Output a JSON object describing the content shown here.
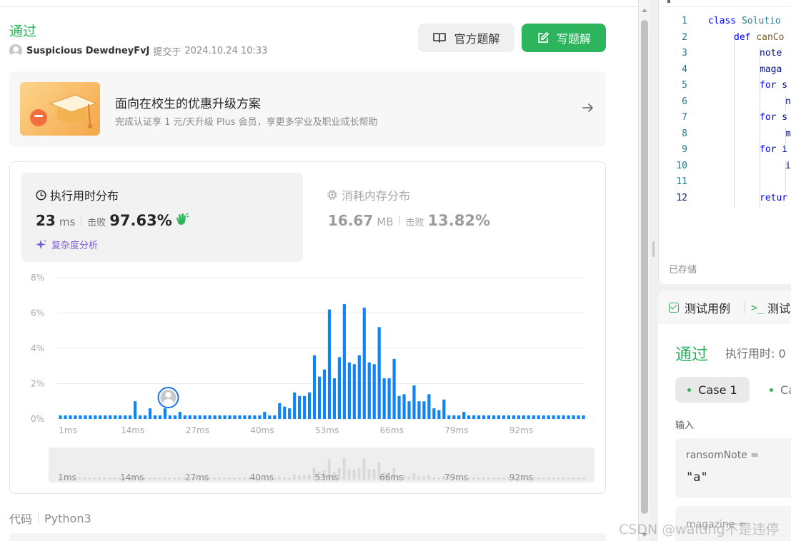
{
  "submission": {
    "status": "通过",
    "user": "Suspicious DewdneyFvJ",
    "submitted_prefix": "提交于",
    "submitted_at": "2024.10.24 10:33",
    "official_solution_label": "官方题解",
    "write_solution_label": "写题解"
  },
  "promo": {
    "title": "面向在校生的优惠升级方案",
    "subtitle": "完成认证享 1 元/天升级 Plus 会员，享更多学业及职业成长帮助"
  },
  "runtime": {
    "label": "执行用时分布",
    "value": "23",
    "unit": "ms",
    "beat_label": "击败",
    "beat_pct": "97.63%",
    "analysis_label": "复杂度分析"
  },
  "memory": {
    "label": "消耗内存分布",
    "value": "16.67",
    "unit": "MB",
    "beat_label": "击败",
    "beat_pct": "13.82%"
  },
  "chart_data": {
    "type": "bar",
    "title": "",
    "xlabel": "",
    "ylabel": "",
    "ylim": [
      0,
      8
    ],
    "y_tick_labels": [
      "0%",
      "2%",
      "4%",
      "6%",
      "8%"
    ],
    "x_tick_labels": [
      "1ms",
      "14ms",
      "27ms",
      "40ms",
      "53ms",
      "66ms",
      "79ms",
      "92ms"
    ],
    "x": [
      1,
      2,
      3,
      4,
      5,
      6,
      7,
      8,
      9,
      10,
      11,
      12,
      13,
      14,
      15,
      16,
      17,
      18,
      19,
      20,
      21,
      22,
      23,
      24,
      25,
      26,
      27,
      28,
      29,
      30,
      31,
      32,
      33,
      34,
      35,
      36,
      37,
      38,
      39,
      40,
      41,
      42,
      43,
      44,
      45,
      46,
      47,
      48,
      49,
      50,
      51,
      52,
      53,
      54,
      55,
      56,
      57,
      58,
      59,
      60,
      61,
      62,
      63,
      64,
      65,
      66,
      67,
      68,
      69,
      70,
      71,
      72,
      73,
      74,
      75,
      76,
      77,
      78,
      79,
      80,
      81,
      82,
      83,
      84,
      85,
      86,
      87,
      88,
      89,
      90,
      91,
      92,
      93,
      94,
      95,
      96,
      97,
      98,
      99,
      100,
      101,
      102,
      103,
      104,
      105,
      106
    ],
    "values": [
      0.2,
      0.2,
      0.2,
      0.2,
      0.2,
      0.2,
      0.2,
      0.2,
      0.2,
      0.2,
      0.2,
      0.2,
      0.2,
      0.2,
      0.2,
      1.0,
      0.2,
      0.2,
      0.6,
      0.2,
      0.2,
      0.6,
      0.2,
      0.2,
      0.4,
      0.2,
      0.2,
      0.2,
      0.2,
      0.2,
      0.2,
      0.2,
      0.2,
      0.2,
      0.2,
      0.2,
      0.2,
      0.2,
      0.2,
      0.2,
      0.2,
      0.4,
      0.2,
      0.2,
      0.9,
      0.7,
      0.6,
      1.5,
      1.3,
      1.3,
      1.5,
      3.6,
      2.4,
      2.8,
      6.2,
      2.3,
      3.5,
      6.5,
      3.2,
      3.1,
      3.6,
      6.3,
      3.2,
      3.1,
      5.2,
      2.3,
      2.3,
      3.4,
      1.3,
      1.4,
      1.0,
      1.9,
      1.0,
      1.0,
      1.4,
      0.6,
      0.5,
      1.1,
      0.2,
      0.2,
      0.2,
      0.4,
      0.2,
      0.2,
      0.2,
      0.2,
      0.2,
      0.2,
      0.2,
      0.2,
      0.2,
      0.2,
      0.2,
      0.2,
      0.2,
      0.2,
      0.2,
      0.2,
      0.2,
      0.2,
      0.2,
      0.2,
      0.2,
      0.2,
      0.2,
      0.2
    ],
    "highlight_x": 23,
    "grid": true
  },
  "code_footer": {
    "label": "代码",
    "language": "Python3"
  },
  "editor": {
    "line_numbers": [
      "1",
      "2",
      "3",
      "4",
      "5",
      "6",
      "7",
      "8",
      "9",
      "10",
      "11",
      "12"
    ],
    "lines": [
      {
        "indent": 0,
        "kw": "class",
        "rest": "Solutio",
        "cls": true
      },
      {
        "indent": 1,
        "kw": "def",
        "rest": "canCo",
        "fn": true
      },
      {
        "indent": 2,
        "kw": "",
        "rest": "note"
      },
      {
        "indent": 2,
        "kw": "",
        "rest": "maga"
      },
      {
        "indent": 2,
        "kw": "for",
        "rest": "s"
      },
      {
        "indent": 3,
        "kw": "",
        "rest": "n"
      },
      {
        "indent": 2,
        "kw": "for",
        "rest": "s"
      },
      {
        "indent": 3,
        "kw": "",
        "rest": "m"
      },
      {
        "indent": 2,
        "kw": "for",
        "rest": "i"
      },
      {
        "indent": 3,
        "kw": "",
        "rest": "i"
      },
      {
        "indent": 4,
        "kw": "",
        "rest": ""
      },
      {
        "indent": 2,
        "kw": "retur",
        "rest": ""
      }
    ],
    "saved_label": "已存储"
  },
  "test_panel": {
    "tab_testcase": "测试用例",
    "tab_result": "测试",
    "status": "通过",
    "runtime_label": "执行用时: 0",
    "case1": "Case 1",
    "case2": "Ca",
    "input_label": "输入",
    "var1_name": "ransomNote =",
    "var1_value": "\"a\"",
    "var2_name": "magazine ="
  },
  "watermark": "CSDN @waiting不是违停",
  "colors": {
    "accent_green": "#2db55d",
    "bar_blue": "#0a84ff",
    "mini_bar": "#d9d9d9"
  }
}
